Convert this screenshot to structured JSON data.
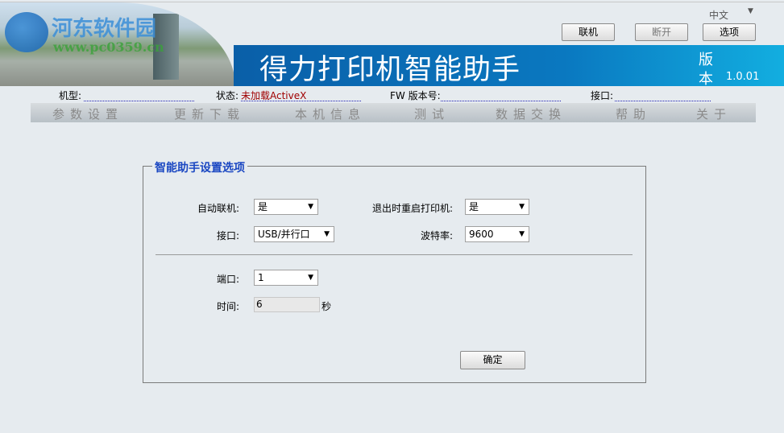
{
  "header": {
    "watermark_name": "河东软件园",
    "watermark_url": "www.pc0359.cn",
    "title": "得力打印机智能助手",
    "version_label_1": "版",
    "version_label_2": "本",
    "version": "1.0.01",
    "language": "中文",
    "buttons": {
      "connect": "联机",
      "disconnect": "断开",
      "options": "选项"
    }
  },
  "info": {
    "model_label": "机型:",
    "status_label": "状态:",
    "status_value": "未加载ActiveX",
    "fw_label": "FW 版本号:",
    "port_label": "接口:"
  },
  "nav": [
    "参数设置",
    "更新下载",
    "本机信息",
    "测试",
    "数据交换",
    "帮助",
    "关于"
  ],
  "settings": {
    "legend": "智能助手设置选项",
    "auto_connect_label": "自动联机:",
    "auto_connect_value": "是",
    "restart_label": "退出时重启打印机:",
    "restart_value": "是",
    "interface_label": "接口:",
    "interface_value": "USB/并行口",
    "baud_label": "波特率:",
    "baud_value": "9600",
    "port_label": "端口:",
    "port_value": "1",
    "time_label": "时间:",
    "time_value": "6",
    "time_unit": "秒",
    "ok": "确定"
  }
}
